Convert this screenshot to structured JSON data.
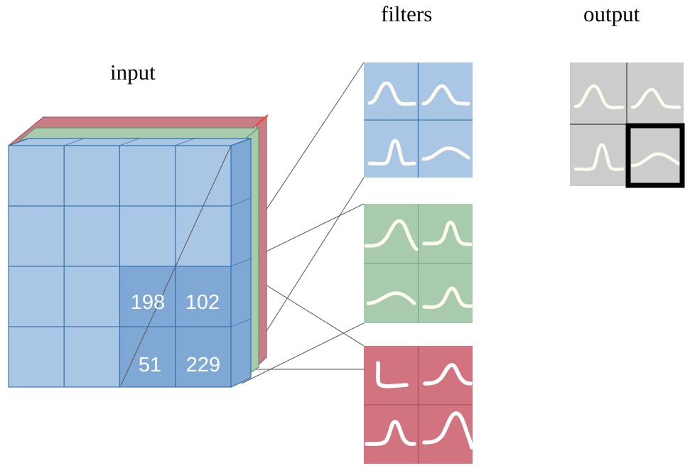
{
  "diagram": {
    "title_labels": {
      "input": "input",
      "filters": "filters",
      "output": "output"
    },
    "colors": {
      "blue_face": "#a9c6e4",
      "blue_face_highlight": "#7fa8d4",
      "blue_edge": "#2f6fae",
      "blue_side": "#7fa8d4",
      "green_face": "#a9cbad",
      "green_edge": "#5f9a6a",
      "red_face": "#c97d87",
      "red_edge": "#a8505e",
      "filter_blue": "#a9c6e4",
      "filter_green": "#a9cbad",
      "filter_red": "#d27480",
      "output_gray": "#cccccc",
      "curve_white": "#fdfaf0",
      "connector_line": "#555555",
      "highlight_border": "#000000",
      "background": "#ffffff"
    },
    "input_volume": {
      "grid_rows": 4,
      "grid_cols": 4,
      "channels": 3,
      "channel_names": [
        "blue",
        "green",
        "red"
      ],
      "highlighted_patch": {
        "rows": [
          3,
          4
        ],
        "cols": [
          3,
          4
        ],
        "values": [
          [
            "198",
            "102"
          ],
          [
            "51",
            "229"
          ]
        ]
      },
      "patch_values_flat": [
        "198",
        "102",
        "51",
        "229"
      ]
    },
    "filters": [
      {
        "channel": "blue",
        "cells": [
          "curve-wide-peak-left",
          "curve-narrow-peak-right",
          "curve-sharp-peak-center",
          "curve-broad-low-arc"
        ]
      },
      {
        "channel": "green",
        "cells": [
          "curve-tall-peak-center",
          "curve-narrow-peak-right",
          "curve-broad-low-arc",
          "curve-medium-peak-center"
        ]
      },
      {
        "channel": "red",
        "cells": [
          "curve-step-hook-left",
          "curve-medium-peak-center",
          "curve-sharp-peak-center",
          "curve-tall-peak-right"
        ]
      }
    ],
    "output": {
      "rows": 2,
      "cols": 2,
      "cells": [
        "curve-wide-peak-left",
        "curve-narrow-peak-right",
        "curve-sharp-peak-center",
        "curve-broad-low-arc"
      ],
      "highlighted_cell_index": 3
    }
  }
}
